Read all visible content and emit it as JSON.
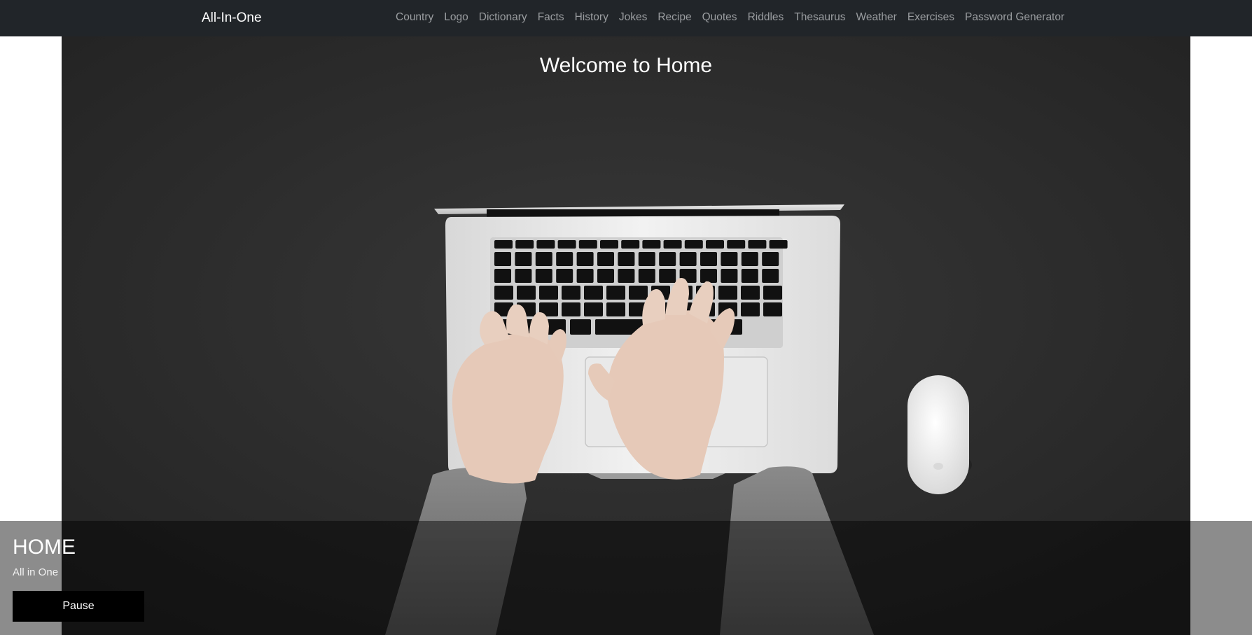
{
  "navbar": {
    "brand": "All-In-One",
    "links": [
      "Country",
      "Logo",
      "Dictionary",
      "Facts",
      "History",
      "Jokes",
      "Recipe",
      "Quotes",
      "Riddles",
      "Thesaurus",
      "Weather",
      "Exercises",
      "Password Generator"
    ]
  },
  "hero": {
    "title": "Welcome to Home"
  },
  "caption": {
    "title": "HOME",
    "subtitle": "All in One",
    "button_label": "Pause"
  },
  "colors": {
    "navbar_bg": "#212529",
    "nav_link": "#9a9da0",
    "hero_bg": "#2c2c2c",
    "button_bg": "#000000"
  }
}
